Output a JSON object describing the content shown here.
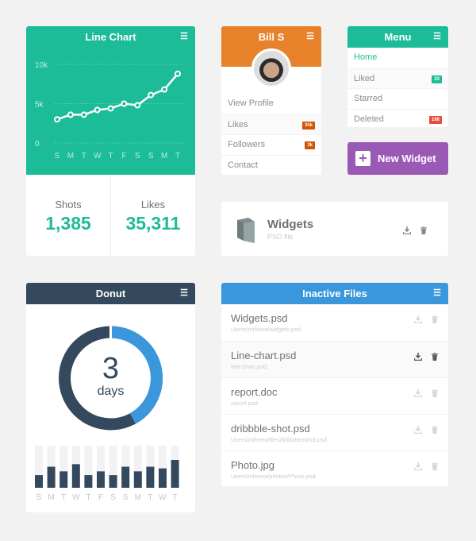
{
  "colors": {
    "teal": "#1dbc98",
    "orange": "#e8822a",
    "purple": "#9b59b6",
    "navy": "#34495e",
    "blue": "#3b97dc",
    "red": "#e74c3c",
    "dark_orange": "#d35400"
  },
  "line_card": {
    "title": "Line Chart",
    "stats": [
      {
        "label": "Shots",
        "value": "1,385"
      },
      {
        "label": "Likes",
        "value": "35,311"
      }
    ]
  },
  "chart_data": [
    {
      "type": "line",
      "x": [
        "S",
        "M",
        "T",
        "W",
        "T",
        "F",
        "S",
        "S",
        "M",
        "T"
      ],
      "values": [
        3000,
        3600,
        3600,
        4200,
        4400,
        5000,
        4800,
        6100,
        6800,
        8800
      ],
      "yticks": [
        "0",
        "5k",
        "10k"
      ],
      "ylim": [
        0,
        10000
      ],
      "grid": true
    },
    {
      "type": "bar",
      "categories": [
        "S",
        "M",
        "T",
        "W",
        "T",
        "F",
        "S",
        "S",
        "M",
        "T",
        "W",
        "T"
      ],
      "values": [
        0.3,
        0.5,
        0.39,
        0.56,
        0.3,
        0.39,
        0.3,
        0.5,
        0.39,
        0.5,
        0.46,
        0.66
      ],
      "ylim": [
        0,
        1
      ]
    }
  ],
  "profile": {
    "name": "Bill S",
    "items": [
      {
        "label": "View Profile"
      },
      {
        "label": "Likes",
        "badge": "35k"
      },
      {
        "label": "Followers",
        "badge": "3k"
      },
      {
        "label": "Contact"
      }
    ]
  },
  "menu": {
    "title": "Menu",
    "items": [
      {
        "label": "Home",
        "active": true
      },
      {
        "label": "Liked",
        "badge": "23"
      },
      {
        "label": "Starred"
      },
      {
        "label": "Deleted",
        "badge": "186"
      }
    ]
  },
  "new_widget": {
    "label": "New Widget",
    "icon": "plus-icon"
  },
  "widget_file": {
    "name": "Widgets",
    "type": "PSD file",
    "icon": "book-icon"
  },
  "donut": {
    "title": "Donut",
    "value": "3",
    "unit": "days",
    "fraction": 0.43
  },
  "files": {
    "title": "Inactive Files",
    "items": [
      {
        "name": "Widgets.psd",
        "path": "Users/mihnea/widgets.psd"
      },
      {
        "name": "Line-chart.psd",
        "path": "line-chart.psd",
        "active": true
      },
      {
        "name": "report.doc",
        "path": "report.psd"
      },
      {
        "name": "dribbble-shot.psd",
        "path": "Users/mihnea/files/dribbble/shot.psd"
      },
      {
        "name": "Photo.jpg",
        "path": "Users/mihnea/photos/Photo.psd"
      }
    ]
  }
}
